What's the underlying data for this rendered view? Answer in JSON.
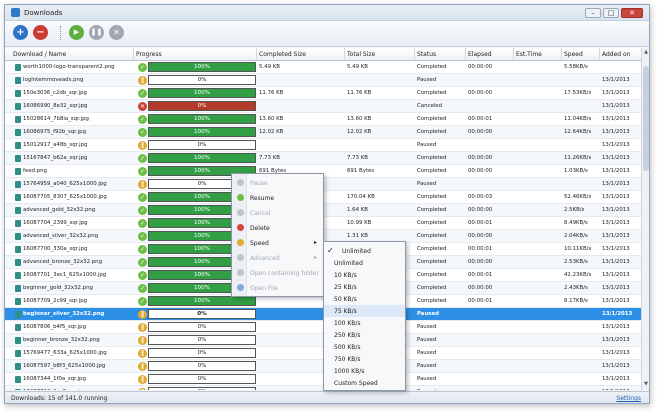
{
  "window": {
    "title": "Downloads"
  },
  "toolbar": {
    "buttons": [
      "add",
      "remove",
      "resume",
      "pause",
      "cancel"
    ]
  },
  "columns": [
    "Download / Name",
    "Progress",
    "Completed Size",
    "Total Size",
    "Status",
    "Elapsed",
    "Est.Time",
    "Speed",
    "Added on"
  ],
  "rows": [
    {
      "name": "worth1000-logo-transparent2.png",
      "progress": "100%",
      "pct": 100,
      "completed": "5.49 KB",
      "total": "5.49 KB",
      "status": "Completed",
      "elapsed": "00:00:00",
      "est": "",
      "speed": "5.58KB/s",
      "added": "",
      "state": "completed"
    },
    {
      "name": "loglntemmoveads.png",
      "progress": "0%",
      "pct": 0,
      "completed": "",
      "total": "",
      "status": "Paused",
      "elapsed": "",
      "est": "",
      "speed": "",
      "added": "13/1/2013",
      "state": "paused"
    },
    {
      "name": "150e3036_c2db_sqr.jpg",
      "progress": "100%",
      "pct": 100,
      "completed": "11.76 KB",
      "total": "11.76 KB",
      "status": "Completed",
      "elapsed": "00:00:00",
      "est": "",
      "speed": "17.53KB/s",
      "added": "13/1/2013",
      "state": "completed"
    },
    {
      "name": "16086990_8e32_sqr.jpg",
      "progress": "0%",
      "pct": 100,
      "completed": "",
      "total": "",
      "status": "Canceled",
      "elapsed": "",
      "est": "",
      "speed": "",
      "added": "13/1/2013",
      "state": "canceled"
    },
    {
      "name": "15028614_7b8ia_sqr.jpg",
      "progress": "100%",
      "pct": 100,
      "completed": "13.60 KB",
      "total": "13.60 KB",
      "status": "Completed",
      "elapsed": "00:00:01",
      "est": "",
      "speed": "11.04KB/s",
      "added": "13/1/2013",
      "state": "completed"
    },
    {
      "name": "16086975_f92b_sqr.jpg",
      "progress": "100%",
      "pct": 100,
      "completed": "12.02 KB",
      "total": "12.02 KB",
      "status": "Completed",
      "elapsed": "00:00:00",
      "est": "",
      "speed": "12.64KB/s",
      "added": "13/1/2013",
      "state": "completed"
    },
    {
      "name": "15012917_a48b_sqr.jpg",
      "progress": "0%",
      "pct": 0,
      "completed": "",
      "total": "",
      "status": "Paused",
      "elapsed": "",
      "est": "",
      "speed": "",
      "added": "13/1/2013",
      "state": "paused"
    },
    {
      "name": "15167847_b62a_sqr.jpg",
      "progress": "100%",
      "pct": 100,
      "completed": "7.73 KB",
      "total": "7.73 KB",
      "status": "Completed",
      "elapsed": "00:00:00",
      "est": "",
      "speed": "11.26KB/s",
      "added": "13/1/2013",
      "state": "completed"
    },
    {
      "name": "feed.png",
      "progress": "100%",
      "pct": 100,
      "completed": "691 Bytes",
      "total": "691 Bytes",
      "status": "Completed",
      "elapsed": "00:00:00",
      "est": "",
      "speed": "1.03KB/s",
      "added": "13/1/2013",
      "state": "completed"
    },
    {
      "name": "15764959_a040_625x1000.jpg",
      "progress": "0%",
      "pct": 0,
      "completed": "",
      "total": "",
      "status": "Paused",
      "elapsed": "",
      "est": "",
      "speed": "",
      "added": "13/1/2013",
      "state": "paused"
    },
    {
      "name": "16087705_8307_625x1000.jpg",
      "progress": "100%",
      "pct": 100,
      "completed": "",
      "total": "170.04 KB",
      "status": "Completed",
      "elapsed": "00:00:03",
      "est": "",
      "speed": "52.46KB/s",
      "added": "13/1/2013",
      "state": "completed"
    },
    {
      "name": "advanced_gold_32x32.png",
      "progress": "100%",
      "pct": 100,
      "completed": "",
      "total": "1.64 KB",
      "status": "Completed",
      "elapsed": "00:00:00",
      "est": "",
      "speed": "2.5KB/s",
      "added": "13/1/2013",
      "state": "completed"
    },
    {
      "name": "16087704_2399_sqr.jpg",
      "progress": "100%",
      "pct": 100,
      "completed": "",
      "total": "10.99 KB",
      "status": "Completed",
      "elapsed": "00:00:01",
      "est": "",
      "speed": "8.49KB/s",
      "added": "13/1/2013",
      "state": "completed"
    },
    {
      "name": "advanced_silver_32x32.png",
      "progress": "100%",
      "pct": 100,
      "completed": "",
      "total": "1.31 KB",
      "status": "Completed",
      "elapsed": "00:00:00",
      "est": "",
      "speed": "2.04KB/s",
      "added": "13/1/2013",
      "state": "completed"
    },
    {
      "name": "16087700_330a_sqr.jpg",
      "progress": "100%",
      "pct": 100,
      "completed": "",
      "total": "",
      "status": "Completed",
      "elapsed": "00:00:01",
      "est": "",
      "speed": "10.11KB/s",
      "added": "13/1/2013",
      "state": "completed"
    },
    {
      "name": "advanced_bronze_32x32.png",
      "progress": "100%",
      "pct": 100,
      "completed": "",
      "total": "",
      "status": "Completed",
      "elapsed": "00:00:00",
      "est": "",
      "speed": "2.53KB/s",
      "added": "13/1/2013",
      "state": "completed"
    },
    {
      "name": "16087701_3ec1_625x1000.jpg",
      "progress": "100%",
      "pct": 100,
      "completed": "",
      "total": "",
      "status": "Completed",
      "elapsed": "00:00:01",
      "est": "",
      "speed": "42.23KB/s",
      "added": "13/1/2013",
      "state": "completed"
    },
    {
      "name": "beginner_gold_32x32.png",
      "progress": "100%",
      "pct": 100,
      "completed": "",
      "total": "",
      "status": "Completed",
      "elapsed": "00:00:00",
      "est": "",
      "speed": "2.43KB/s",
      "added": "13/1/2013",
      "state": "completed"
    },
    {
      "name": "16087709_2c99_sqr.jpg",
      "progress": "100%",
      "pct": 100,
      "completed": "",
      "total": "",
      "status": "Completed",
      "elapsed": "00:00:01",
      "est": "",
      "speed": "8.17KB/s",
      "added": "13/1/2013",
      "state": "completed"
    },
    {
      "name": "beginner_silver_32x32.png",
      "progress": "0%",
      "pct": 0,
      "completed": "",
      "total": "",
      "status": "Paused",
      "elapsed": "",
      "est": "",
      "speed": "",
      "added": "13/1/2013",
      "state": "paused",
      "selected": true
    },
    {
      "name": "16087806_b4f5_sqr.jpg",
      "progress": "0%",
      "pct": 0,
      "completed": "",
      "total": "",
      "status": "Paused",
      "elapsed": "",
      "est": "",
      "speed": "",
      "added": "13/1/2013",
      "state": "paused"
    },
    {
      "name": "beginner_bronze_32x32.png",
      "progress": "0%",
      "pct": 0,
      "completed": "",
      "total": "",
      "status": "Paused",
      "elapsed": "",
      "est": "",
      "speed": "",
      "added": "13/1/2013",
      "state": "paused"
    },
    {
      "name": "15769477_633a_625x1000.jpg",
      "progress": "0%",
      "pct": 0,
      "completed": "",
      "total": "",
      "status": "Paused",
      "elapsed": "",
      "est": "",
      "speed": "",
      "added": "13/1/2013",
      "state": "paused"
    },
    {
      "name": "16087597_b8f3_625x1000.jpg",
      "progress": "0%",
      "pct": 0,
      "completed": "",
      "total": "",
      "status": "Paused",
      "elapsed": "",
      "est": "",
      "speed": "",
      "added": "13/1/2013",
      "state": "paused"
    },
    {
      "name": "16087344_1f0a_sqr.jpg",
      "progress": "0%",
      "pct": 0,
      "completed": "",
      "total": "",
      "status": "Paused",
      "elapsed": "",
      "est": "",
      "speed": "",
      "added": "13/1/2013",
      "state": "paused"
    },
    {
      "name": "16087713_2cc7_sqr.jpg",
      "progress": "0%",
      "pct": 0,
      "completed": "",
      "total": "",
      "status": "Paused",
      "elapsed": "",
      "est": "",
      "speed": "",
      "added": "13/1/2013",
      "state": "paused"
    }
  ],
  "context_menu": {
    "items": [
      {
        "label": "Pause",
        "enabled": false,
        "icon": "pause-icon"
      },
      {
        "label": "Resume",
        "enabled": true,
        "icon": "resume-icon"
      },
      {
        "label": "Cancel",
        "enabled": false,
        "icon": "cancel-icon"
      },
      {
        "label": "Delete",
        "enabled": true,
        "icon": "delete-icon"
      },
      {
        "label": "Speed",
        "enabled": true,
        "icon": "speed-icon",
        "submenu": true
      },
      {
        "label": "Advanced",
        "enabled": false,
        "icon": "advanced-icon",
        "submenu": true
      },
      {
        "label": "Open containing folder",
        "enabled": false,
        "icon": "folder-icon"
      },
      {
        "label": "Open File",
        "enabled": false,
        "icon": "file-icon"
      }
    ]
  },
  "speed_menu": {
    "header": "Unlimited",
    "items": [
      "Unlimited",
      "10 KB/s",
      "25 KB/s",
      "50 KB/s",
      "75 KB/s",
      "100 KB/s",
      "250 KB/s",
      "500 KB/s",
      "750 KB/s",
      "1000 KB/s",
      "Custom Speed"
    ]
  },
  "status": {
    "left": "Downloads: 15 of 141.0 running",
    "right": "Settings"
  }
}
